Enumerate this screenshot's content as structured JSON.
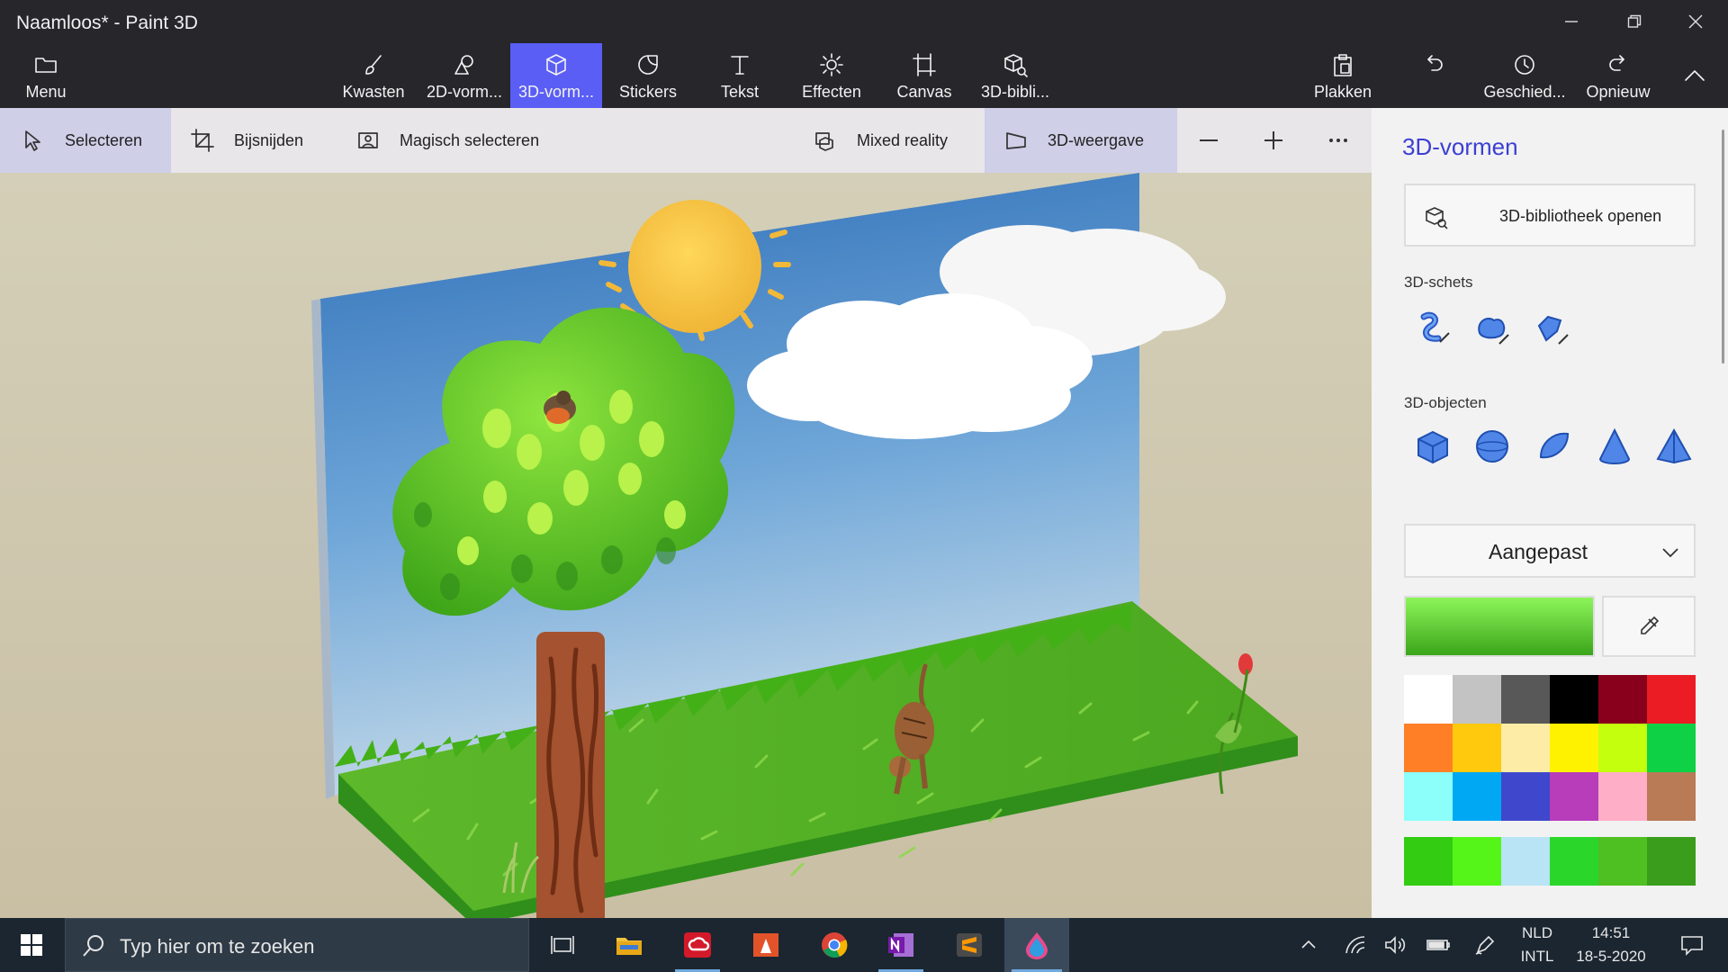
{
  "window": {
    "title": "Naamloos* - Paint 3D"
  },
  "ribbon": {
    "menu_label": "Menu",
    "tools": [
      {
        "label": "Kwasten",
        "icon": "brush-icon"
      },
      {
        "label": "2D-vorm...",
        "icon": "2d-shapes-icon"
      },
      {
        "label": "3D-vorm...",
        "icon": "3d-shapes-icon",
        "active": true
      },
      {
        "label": "Stickers",
        "icon": "stickers-icon"
      },
      {
        "label": "Tekst",
        "icon": "text-icon"
      },
      {
        "label": "Effecten",
        "icon": "effects-icon"
      },
      {
        "label": "Canvas",
        "icon": "canvas-icon"
      },
      {
        "label": "3D-bibli...",
        "icon": "3d-library-icon"
      }
    ],
    "paste_label": "Plakken",
    "history_label": "Geschied...",
    "redo_label": "Opnieuw"
  },
  "subbar": {
    "select_label": "Selecteren",
    "crop_label": "Bijsnijden",
    "magic_select_label": "Magisch selecteren",
    "mixed_reality_label": "Mixed reality",
    "view3d_label": "3D-weergave"
  },
  "panel": {
    "title": "3D-vormen",
    "library_button": "3D-bibliotheek openen",
    "sketch_label": "3D-schets",
    "objects_label": "3D-objecten",
    "finish_dropdown": "Aangepast",
    "accent_color": "#3c3fd4",
    "current_color": "#5ed632",
    "palette": [
      "#ffffff",
      "#c3c3c3",
      "#585858",
      "#000000",
      "#88001b",
      "#ec1c24",
      "#ff7f27",
      "#ffc90e",
      "#fdeca6",
      "#fff200",
      "#c4ff0e",
      "#0ed145",
      "#8cfffb",
      "#00a8f3",
      "#3f48cc",
      "#b83dba",
      "#ffaec8",
      "#b97a56"
    ],
    "custom_colors": [
      "#33cc12",
      "#55f51a",
      "#b8e4f5",
      "#2bd62b",
      "#4fc022",
      "#3a9d1c"
    ]
  },
  "taskbar": {
    "search_placeholder": "Typ hier om te zoeken",
    "lang_top": "NLD",
    "lang_bottom": "INTL",
    "time": "14:51",
    "date": "18-5-2020"
  }
}
